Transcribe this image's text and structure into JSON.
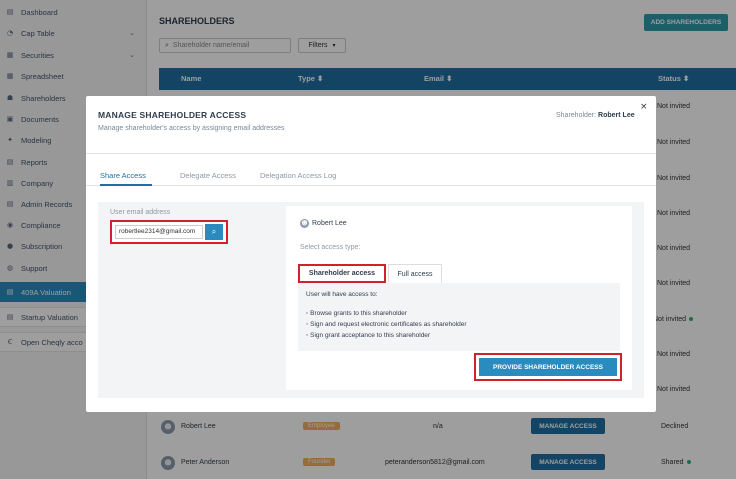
{
  "sidebar": {
    "items": [
      {
        "label": "Dashboard",
        "icon": "dashboard-icon",
        "glyph": "▤"
      },
      {
        "label": "Cap Table",
        "icon": "cap-table-icon",
        "glyph": "◔",
        "chevron": "⌄"
      },
      {
        "label": "Securities",
        "icon": "securities-icon",
        "glyph": "▦",
        "chevron": "⌄"
      },
      {
        "label": "Spreadsheet",
        "icon": "spreadsheet-icon",
        "glyph": "▦"
      },
      {
        "label": "Shareholders",
        "icon": "shareholders-icon",
        "glyph": "☗"
      },
      {
        "label": "Documents",
        "icon": "documents-icon",
        "glyph": "▣"
      },
      {
        "label": "Modeling",
        "icon": "modeling-icon",
        "glyph": "✦"
      },
      {
        "label": "Reports",
        "icon": "reports-icon",
        "glyph": "▤"
      },
      {
        "label": "Company",
        "icon": "company-icon",
        "glyph": "▥"
      },
      {
        "label": "Admin Records",
        "icon": "admin-records-icon",
        "glyph": "▤"
      },
      {
        "label": "Compliance",
        "icon": "compliance-icon",
        "glyph": "◉"
      },
      {
        "label": "Subscription",
        "icon": "subscription-icon",
        "glyph": "●"
      },
      {
        "label": "Support",
        "icon": "support-icon",
        "glyph": "◍"
      },
      {
        "label": "409A Valuation",
        "icon": "valuation-409a-icon",
        "glyph": "▤"
      },
      {
        "label": "Startup Valuation",
        "icon": "startup-valuation-icon",
        "glyph": "▤"
      },
      {
        "label": "Open Cheqly acco",
        "icon": "cheqly-icon",
        "glyph": "Ꞓ"
      }
    ]
  },
  "page": {
    "title": "SHAREHOLDERS",
    "add_button": "ADD SHAREHOLDERS",
    "search_placeholder": "Shareholder name/email",
    "search_icon": "⌕",
    "filters": "Filters",
    "filters_caret": "▾",
    "columns": {
      "name": "Name",
      "type": "Type ⬍",
      "email": "Email ⬍",
      "status": "Status ⬍"
    },
    "status_column": [
      "Not invited",
      "Not invited",
      "Not invited",
      "Not invited",
      "Not invited",
      "Not invited",
      "Not invited",
      "Not invited",
      "Not invited"
    ],
    "rows": [
      {
        "avatar": "☻",
        "name": "Robert Lee",
        "type": "Employee",
        "email": "n/a",
        "action": "MANAGE ACCESS",
        "status": "Declined"
      },
      {
        "avatar": "☻",
        "name": "Peter Anderson",
        "type": "Founder",
        "email": "peteranderson5812@gmail.com",
        "action": "MANAGE ACCESS",
        "status": "Shared"
      }
    ]
  },
  "modal": {
    "title": "MANAGE SHAREHOLDER ACCESS",
    "subtitle": "Manage shareholder's access by assigning email addresses",
    "close": "×",
    "holder_label": "Shareholder:",
    "holder_name": "Robert Lee",
    "tabs": [
      "Share Access",
      "Delegate Access",
      "Delegation Access Log"
    ],
    "email_label": "User email address",
    "email_value": "robertlee2314@gmail.com",
    "email_search_icon": "⌕",
    "panel": {
      "user_avatar": "☻",
      "user": "Robert Lee",
      "select_label": "Select access type:",
      "access_tabs": [
        "Shareholder access",
        "Full access"
      ],
      "intro": "User will have access to:",
      "list": [
        "Browse grants to this shareholder",
        "Sign and request electronic certificates as shareholder",
        "Sign grant acceptance to this shareholder"
      ],
      "button": "PROVIDE SHAREHOLDER ACCESS"
    }
  },
  "colors": {
    "primary": "#1f6fa2",
    "accent": "#2a8bbf",
    "teal": "#2f9aa8",
    "highlight": "#d2202f",
    "badge": "#f4b15a",
    "success": "#2fb36c"
  }
}
